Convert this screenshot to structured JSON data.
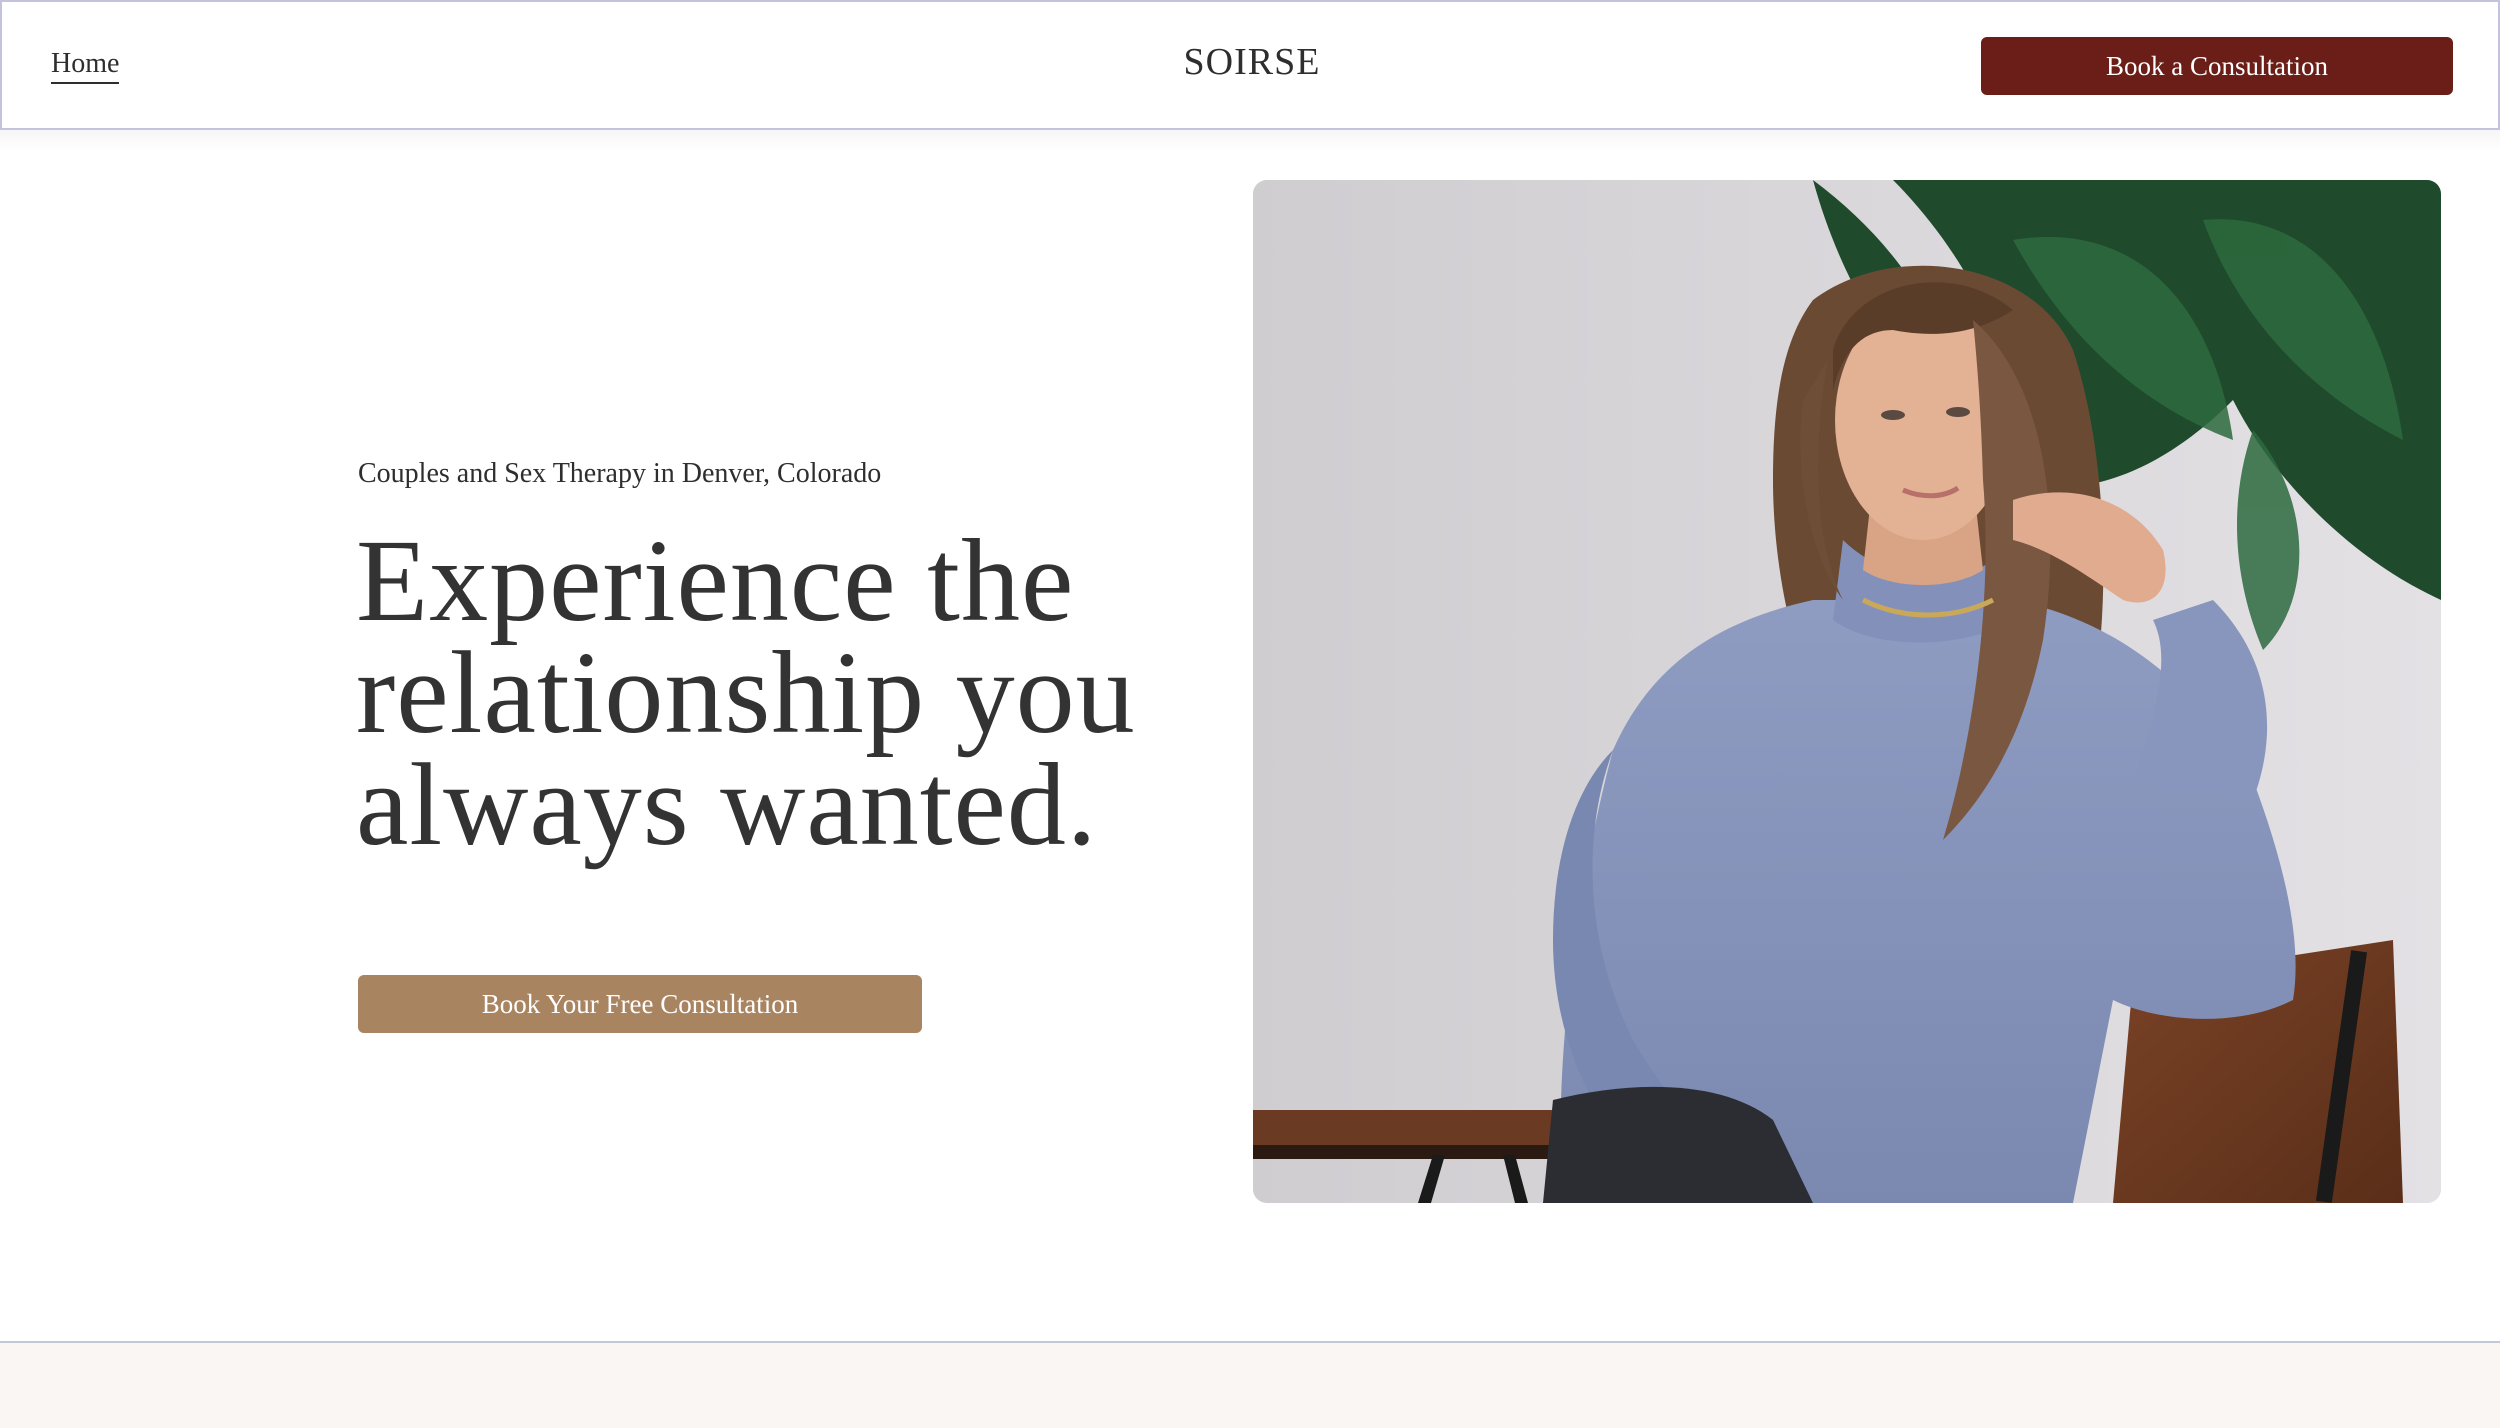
{
  "header": {
    "home_link": "Home",
    "brand": "SOIRSE",
    "cta_label": "Book a Consultation"
  },
  "hero": {
    "subtitle": "Couples and Sex Therapy in Denver, Colorado",
    "title_lines": [
      "Experience the",
      "relationship you",
      "always wanted."
    ],
    "cta_label": "Book Your Free Consultation",
    "image_alt": "Woman in a blue turtleneck sweater seated on a wooden chair beside a large green plant"
  },
  "colors": {
    "header_cta_bg": "#6a1e17",
    "hero_cta_bg": "#a98461",
    "text": "#2e2e2e",
    "footer_band": "#faf6f3"
  }
}
